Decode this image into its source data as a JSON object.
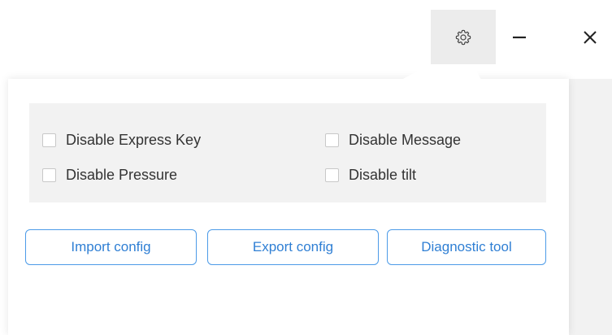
{
  "titlebar": {
    "settings_icon": "gear-icon",
    "minimize_icon": "minimize-icon",
    "close_icon": "close-icon"
  },
  "options": [
    {
      "label": "Disable Express Key",
      "checked": false
    },
    {
      "label": "Disable Message",
      "checked": false
    },
    {
      "label": "Disable Pressure",
      "checked": false
    },
    {
      "label": "Disable tilt",
      "checked": false
    }
  ],
  "buttons": {
    "import_label": "Import config",
    "export_label": "Export config",
    "diagnostic_label": "Diagnostic tool"
  },
  "colors": {
    "accent": "#2f7fd4",
    "panel_bg": "#f2f2f2",
    "gear_bg": "#ececec"
  }
}
